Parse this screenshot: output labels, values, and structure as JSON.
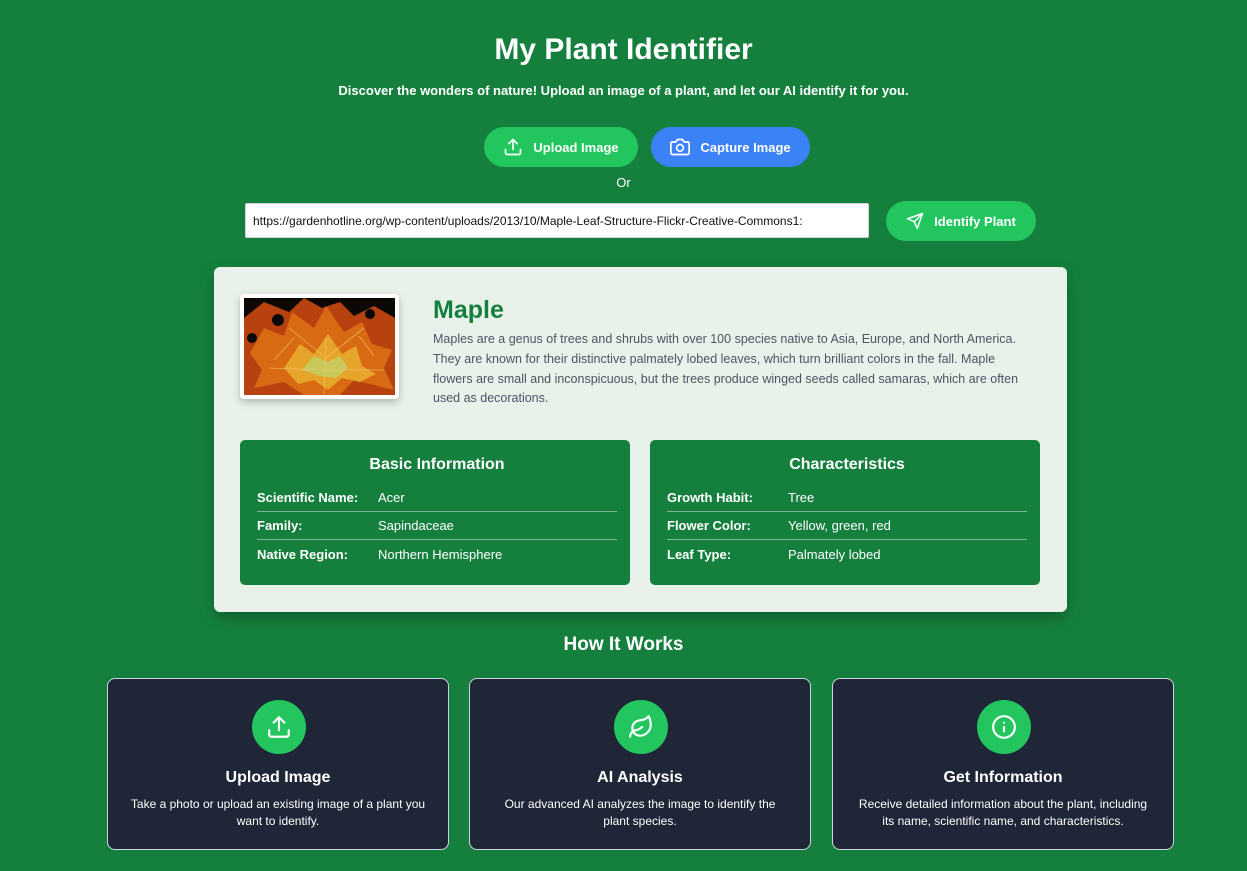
{
  "header": {
    "title": "My Plant Identifier",
    "subtitle": "Discover the wonders of nature! Upload an image of a plant, and let our AI identify it for you."
  },
  "actions": {
    "upload_label": "Upload Image",
    "capture_label": "Capture Image",
    "or_text": "Or",
    "url_value": "https://gardenhotline.org/wp-content/uploads/2013/10/Maple-Leaf-Structure-Flickr-Creative-Commons1:",
    "identify_label": "Identify Plant"
  },
  "result": {
    "name": "Maple",
    "description": "Maples are a genus of trees and shrubs with over 100 species native to Asia, Europe, and North America. They are known for their distinctive palmately lobed leaves, which turn brilliant colors in the fall. Maple flowers are small and inconspicuous, but the trees produce winged seeds called samaras, which are often used as decorations.",
    "basic_info": {
      "title": "Basic Information",
      "rows": [
        {
          "label": "Scientific Name:",
          "value": "Acer"
        },
        {
          "label": "Family:",
          "value": "Sapindaceae"
        },
        {
          "label": "Native Region:",
          "value": "Northern Hemisphere"
        }
      ]
    },
    "characteristics": {
      "title": "Characteristics",
      "rows": [
        {
          "label": "Growth Habit:",
          "value": "Tree"
        },
        {
          "label": "Flower Color:",
          "value": "Yellow, green, red"
        },
        {
          "label": "Leaf Type:",
          "value": "Palmately lobed"
        }
      ]
    }
  },
  "how_it_works": {
    "title": "How It Works",
    "steps": [
      {
        "icon": "upload-icon",
        "title": "Upload Image",
        "description": "Take a photo or upload an existing image of a plant you want to identify."
      },
      {
        "icon": "leaf-icon",
        "title": "AI Analysis",
        "description": "Our advanced AI analyzes the image to identify the plant species."
      },
      {
        "icon": "info-icon",
        "title": "Get Information",
        "description": "Receive detailed information about the plant, including its name, scientific name, and characteristics."
      }
    ]
  },
  "colors": {
    "background": "#15803d",
    "accent_green": "#22c55e",
    "accent_blue": "#3b82f6",
    "card_light": "#e8f2ea",
    "card_dark": "#1e2637"
  }
}
